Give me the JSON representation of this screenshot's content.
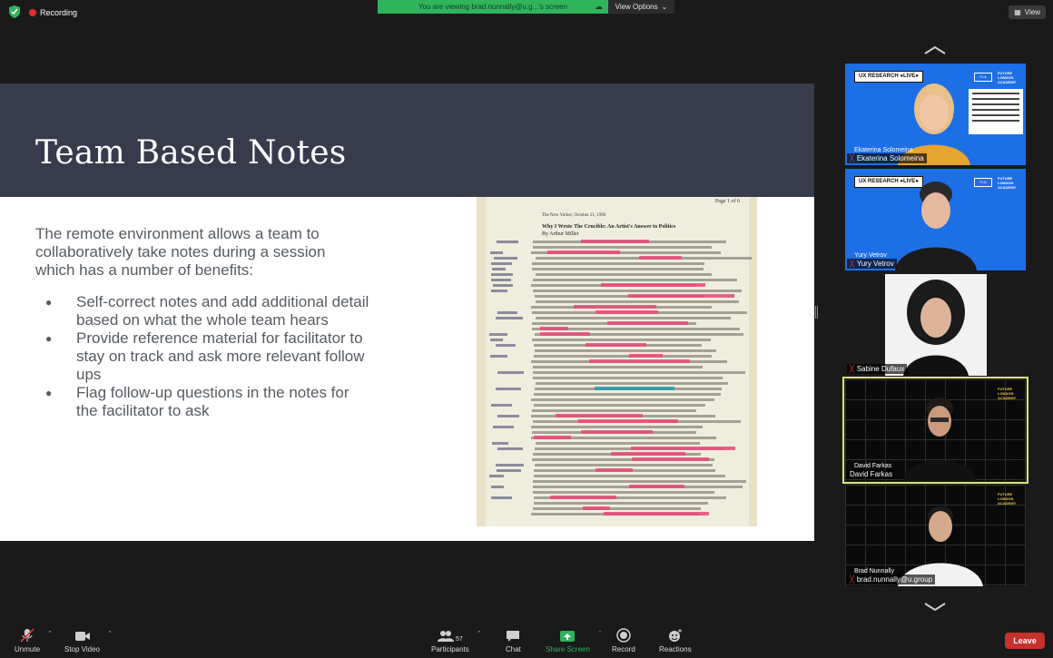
{
  "topbar": {
    "recording_label": "Recording",
    "share_banner": "You are viewing brad.nunnally@u.g...'s screen",
    "view_options": "View Options",
    "view_button": "View"
  },
  "slide": {
    "title": "Team Based Notes",
    "intro": "The remote environment allows a team to collaboratively take notes during a session which has a number of benefits:",
    "bullets": [
      "Self-correct notes and add additional detail based on what the whole team hears",
      "Provide reference material for facilitator to stay on track and ask more relevant follow ups",
      "Flag follow-up questions in the notes for the facilitator to ask"
    ],
    "photo": {
      "page_label": "Page 1 of 6",
      "header_date": "The New Yorker, October 21, 1996",
      "headline": "Why I Wrote The Crucible: An Artist's Answer to Politics",
      "byline": "By Arthur Miller"
    }
  },
  "participants": [
    {
      "name": "Ekaterina Solomeina",
      "overlay": "Ekaterina Solomeina",
      "badge": "UX RESEARCH ●LIVE●",
      "brand": "FUTURE LONDON ACADEMY"
    },
    {
      "name": "Yury Vetrov",
      "overlay": "Yury Vetrov",
      "badge": "UX RESEARCH ●LIVE●",
      "brand": "FUTURE LONDON ACADEMY"
    },
    {
      "name": "Sabine Dufaux"
    },
    {
      "name": "David Farkas",
      "overlay": "David Farkas",
      "brand": "FUTURE LONDON ACADEMY"
    },
    {
      "name": "brad.nunnally@u.group",
      "overlay": "Brad Nunnally",
      "brand": "FUTURE LONDON ACADEMY"
    }
  ],
  "controls": {
    "unmute": "Unmute",
    "stop_video": "Stop Video",
    "participants": "Participants",
    "participant_count": "57",
    "chat": "Chat",
    "share_screen": "Share Screen",
    "record": "Record",
    "reactions": "Reactions",
    "leave": "Leave"
  },
  "colors": {
    "slide_header": "#373b4c",
    "share_green": "#2fb45c",
    "leave_red": "#c5312b",
    "active_speaker": "#d9e27a"
  }
}
